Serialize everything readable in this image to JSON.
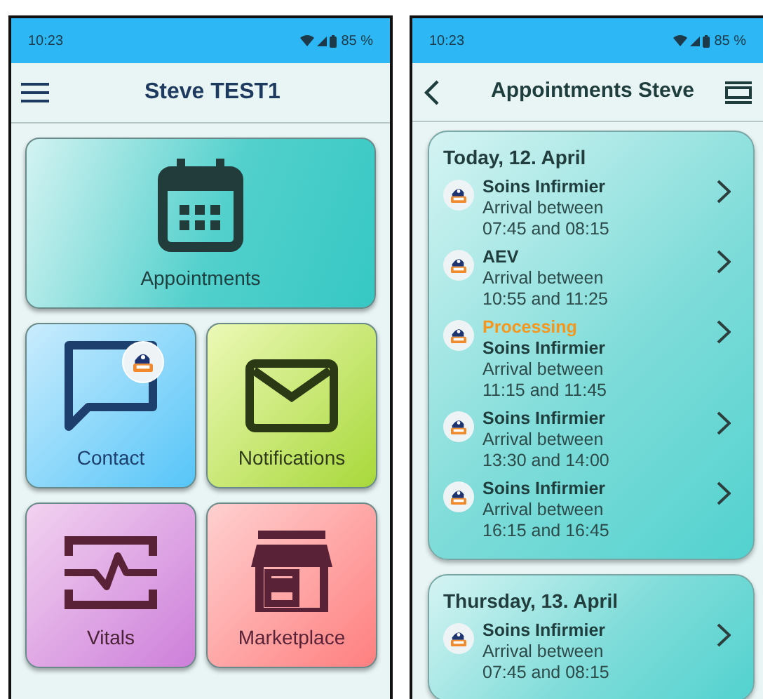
{
  "home_screen": {
    "status_bar": {
      "time": "10:23",
      "battery": "85 %"
    },
    "title": "Steve TEST1",
    "tiles": [
      {
        "kind": "appointments",
        "label": "Appointments",
        "badge": false
      },
      {
        "kind": "contact",
        "label": "Contact",
        "badge": true
      },
      {
        "kind": "notifications",
        "label": "Notifications",
        "badge": false
      },
      {
        "kind": "vitals",
        "label": "Vitals",
        "badge": false
      },
      {
        "kind": "marketplace",
        "label": "Marketplace",
        "badge": false
      }
    ]
  },
  "appointments_screen": {
    "status_bar": {
      "time": "10:23",
      "battery": "85 %"
    },
    "title": "Appointments Steve",
    "days": [
      {
        "date": "Today, 12. April",
        "items": [
          {
            "title": "Soins Infirmier",
            "line1": "Arrival between",
            "line2": "07:45 and 08:15"
          },
          {
            "title": "AEV",
            "line1": "Arrival between",
            "line2": "10:55 and 11:25"
          },
          {
            "status": "Processing",
            "title": "Soins Infirmier",
            "line1": "Arrival between",
            "line2": "11:15 and 11:45"
          },
          {
            "title": "Soins Infirmier",
            "line1": "Arrival between",
            "line2": "13:30 and 14:00"
          },
          {
            "title": "Soins Infirmier",
            "line1": "Arrival between",
            "line2": "16:15 and 16:45"
          }
        ]
      },
      {
        "date": "Thursday, 13. April",
        "items": [
          {
            "title": "Soins Infirmier",
            "line1": "Arrival between",
            "line2": "07:45 and 08:15"
          }
        ]
      }
    ]
  }
}
